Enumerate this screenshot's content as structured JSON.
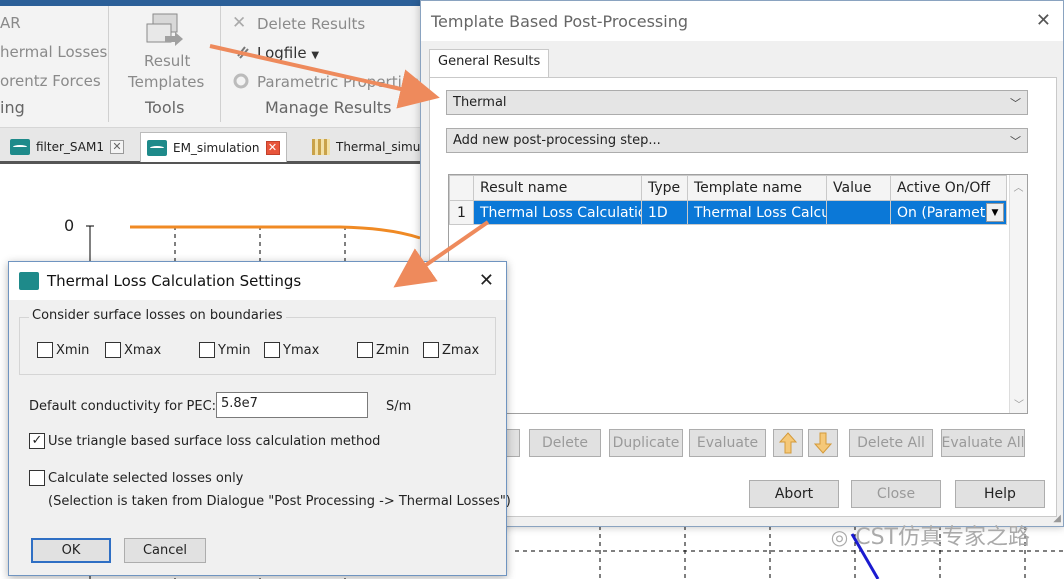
{
  "ribbon": {
    "partial_items": [
      "AR",
      "hermal Losses",
      "orentz Forces",
      "ing"
    ],
    "result_templates_label_1": "Result",
    "result_templates_label_2": "Templates",
    "tools_group": "Tools",
    "delete_results": "Delete Results",
    "logfile": "Logfile",
    "parametric_properties": "Parametric Properties",
    "manage_results_group": "Manage Results"
  },
  "doc_tabs": [
    {
      "label": "filter_SAM1"
    },
    {
      "label": "EM_simulation"
    },
    {
      "label": "Thermal_simula"
    }
  ],
  "plot": {
    "y_tick": "0"
  },
  "template_dialog": {
    "title": "Template Based Post-Processing",
    "tab": "General Results",
    "category_value": "Thermal",
    "step_value": "Add new post-processing step...",
    "columns": [
      "Result name",
      "Type",
      "Template name",
      "Value",
      "Active On/Off"
    ],
    "rows": [
      {
        "num": "1",
        "result_name": "Thermal Loss Calculation",
        "type": "1D",
        "template_name": "Thermal Loss Calcul",
        "value": "",
        "active": "On (Paramet"
      }
    ],
    "buttons": {
      "delete": "Delete",
      "duplicate": "Duplicate",
      "evaluate": "Evaluate",
      "delete_all": "Delete All",
      "evaluate_all": "Evaluate All",
      "abort": "Abort",
      "close": "Close",
      "help": "Help"
    }
  },
  "thermal_dialog": {
    "title": "Thermal Loss Calculation Settings",
    "surface_group": "Consider surface losses on boundaries",
    "checkboxes": [
      "Xmin",
      "Xmax",
      "Ymin",
      "Ymax",
      "Zmin",
      "Zmax"
    ],
    "conductivity_label": "Default conductivity for PEC:",
    "conductivity_value": "5.8e7",
    "conductivity_unit": "S/m",
    "triangle_method": "Use triangle based surface loss calculation method",
    "triangle_checked": true,
    "selected_losses": "Calculate selected losses only",
    "selected_losses_checked": false,
    "selection_note": "(Selection is taken from Dialogue \"Post Processing -> Thermal Losses\")",
    "ok": "OK",
    "cancel": "Cancel"
  },
  "watermark": "CST仿真专家之路",
  "colors": {
    "selection": "#0b78d7",
    "annotation_arrow": "#ee8a5c",
    "curve_orange": "#f08a24",
    "curve_blue": "#1b1bd0"
  }
}
